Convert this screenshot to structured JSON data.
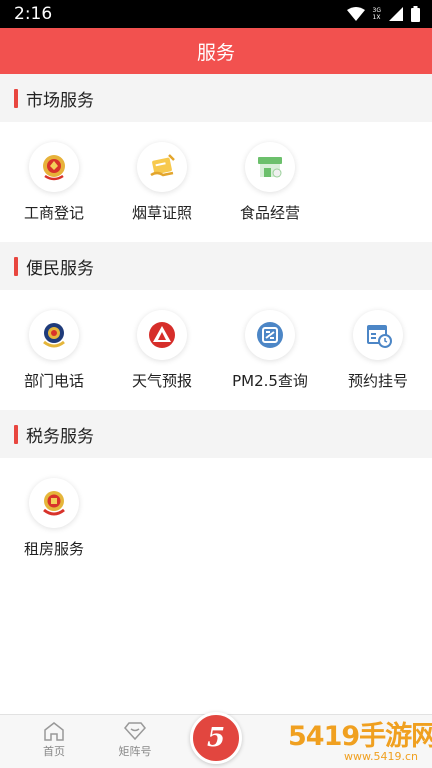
{
  "status_bar": {
    "time": "2:16",
    "network_label_top": "3G",
    "network_label_bottom": "1X"
  },
  "header": {
    "title": "服务"
  },
  "sections": [
    {
      "title": "市场服务",
      "items": [
        {
          "label": "工商登记",
          "icon": "emblem-icon"
        },
        {
          "label": "烟草证照",
          "icon": "license-hand-icon"
        },
        {
          "label": "食品经营",
          "icon": "storefront-icon"
        }
      ]
    },
    {
      "title": "便民服务",
      "items": [
        {
          "label": "部门电话",
          "icon": "police-emblem-icon"
        },
        {
          "label": "天气预报",
          "icon": "weather-logo-icon"
        },
        {
          "label": "PM2.5查询",
          "icon": "air-quality-icon"
        },
        {
          "label": "预约挂号",
          "icon": "calendar-clock-icon"
        }
      ]
    },
    {
      "title": "税务服务",
      "items": [
        {
          "label": "租房服务",
          "icon": "tax-emblem-icon"
        }
      ]
    }
  ],
  "bottom_nav": {
    "items": [
      {
        "label": "首页",
        "icon": "home-icon"
      },
      {
        "label": "矩阵号",
        "icon": "diamond-icon"
      }
    ],
    "center_button": {
      "text": "5"
    }
  },
  "watermark": {
    "text": "5419手游网",
    "url_text": "www.5419.cn"
  },
  "colors": {
    "accent": "#f2514f",
    "section_bar": "#e8463f",
    "background": "#f4f4f4"
  }
}
